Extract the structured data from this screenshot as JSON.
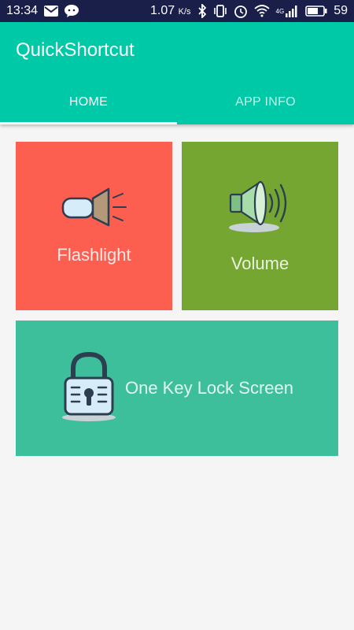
{
  "status_bar": {
    "time": "13:34",
    "speed": "1.07",
    "speed_unit": "K/s",
    "network": "4G",
    "battery": "59"
  },
  "app_bar": {
    "title": "QuickShortcut",
    "tabs": [
      {
        "label": "HOME",
        "active": true
      },
      {
        "label": "APP INFO",
        "active": false
      }
    ]
  },
  "tiles": {
    "flashlight": {
      "label": "Flashlight",
      "icon": "flashlight-icon",
      "color": "#fc5f50"
    },
    "volume": {
      "label": "Volume",
      "icon": "speaker-icon",
      "color": "#76a632"
    },
    "lock": {
      "label": "One Key Lock Screen",
      "icon": "padlock-icon",
      "color": "#3ebf9c"
    }
  },
  "colors": {
    "primary": "#00c9a7",
    "status_bar": "#1a1f4a",
    "background": "#f5f5f5"
  }
}
